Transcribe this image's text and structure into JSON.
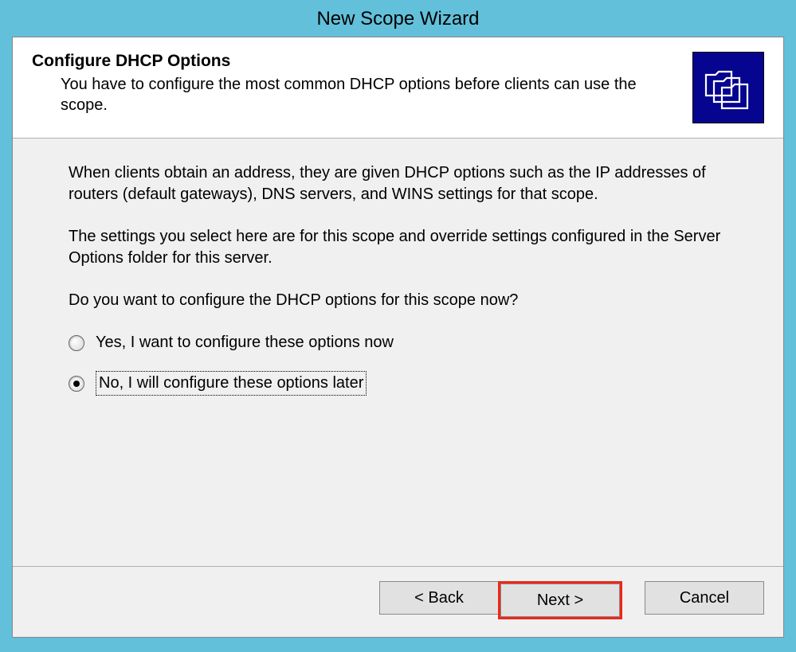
{
  "window": {
    "title": "New Scope Wizard"
  },
  "header": {
    "title": "Configure DHCP Options",
    "subtitle": "You have to configure the most common DHCP options before clients can use the scope."
  },
  "content": {
    "para1": "When clients obtain an address, they are given DHCP options such as the IP addresses of routers (default gateways), DNS servers, and WINS settings for that scope.",
    "para2": "The settings you select here are for this scope and override settings configured in the Server Options folder for this server.",
    "question": "Do you want to configure the DHCP options for this scope now?",
    "options": {
      "yes": "Yes, I want to configure these options now",
      "no": "No, I will configure these options later"
    },
    "selected": "no"
  },
  "footer": {
    "back": "< Back",
    "next": "Next >",
    "cancel": "Cancel"
  }
}
